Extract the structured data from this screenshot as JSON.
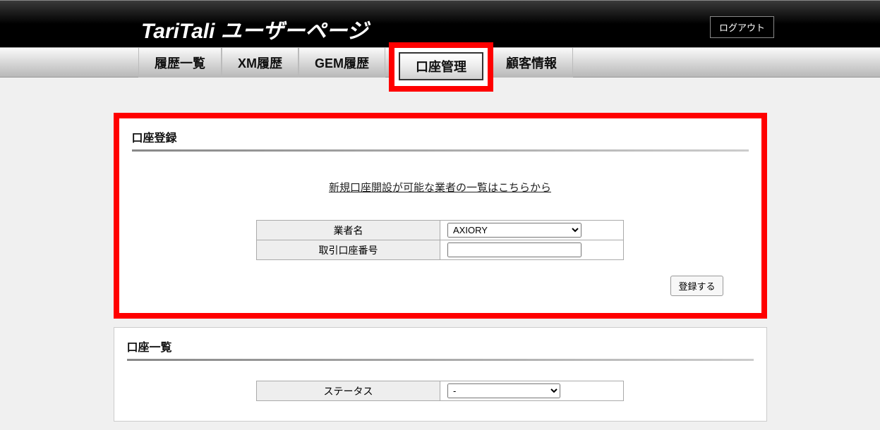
{
  "header": {
    "title": "TariTali ユーザーページ",
    "logout": "ログアウト"
  },
  "nav": {
    "tabs": [
      {
        "label": "履歴一覧"
      },
      {
        "label": "XM履歴"
      },
      {
        "label": "GEM履歴"
      },
      {
        "label": "口座管理"
      },
      {
        "label": "顧客情報"
      }
    ]
  },
  "register": {
    "title": "口座登録",
    "link": "新規口座開設が可能な業者の一覧はこちらから",
    "broker_label": "業者名",
    "broker_selected": "AXIORY",
    "account_label": "取引口座番号",
    "account_value": "",
    "submit": "登録する"
  },
  "list": {
    "title": "口座一覧",
    "status_label": "ステータス",
    "status_selected": "-"
  }
}
